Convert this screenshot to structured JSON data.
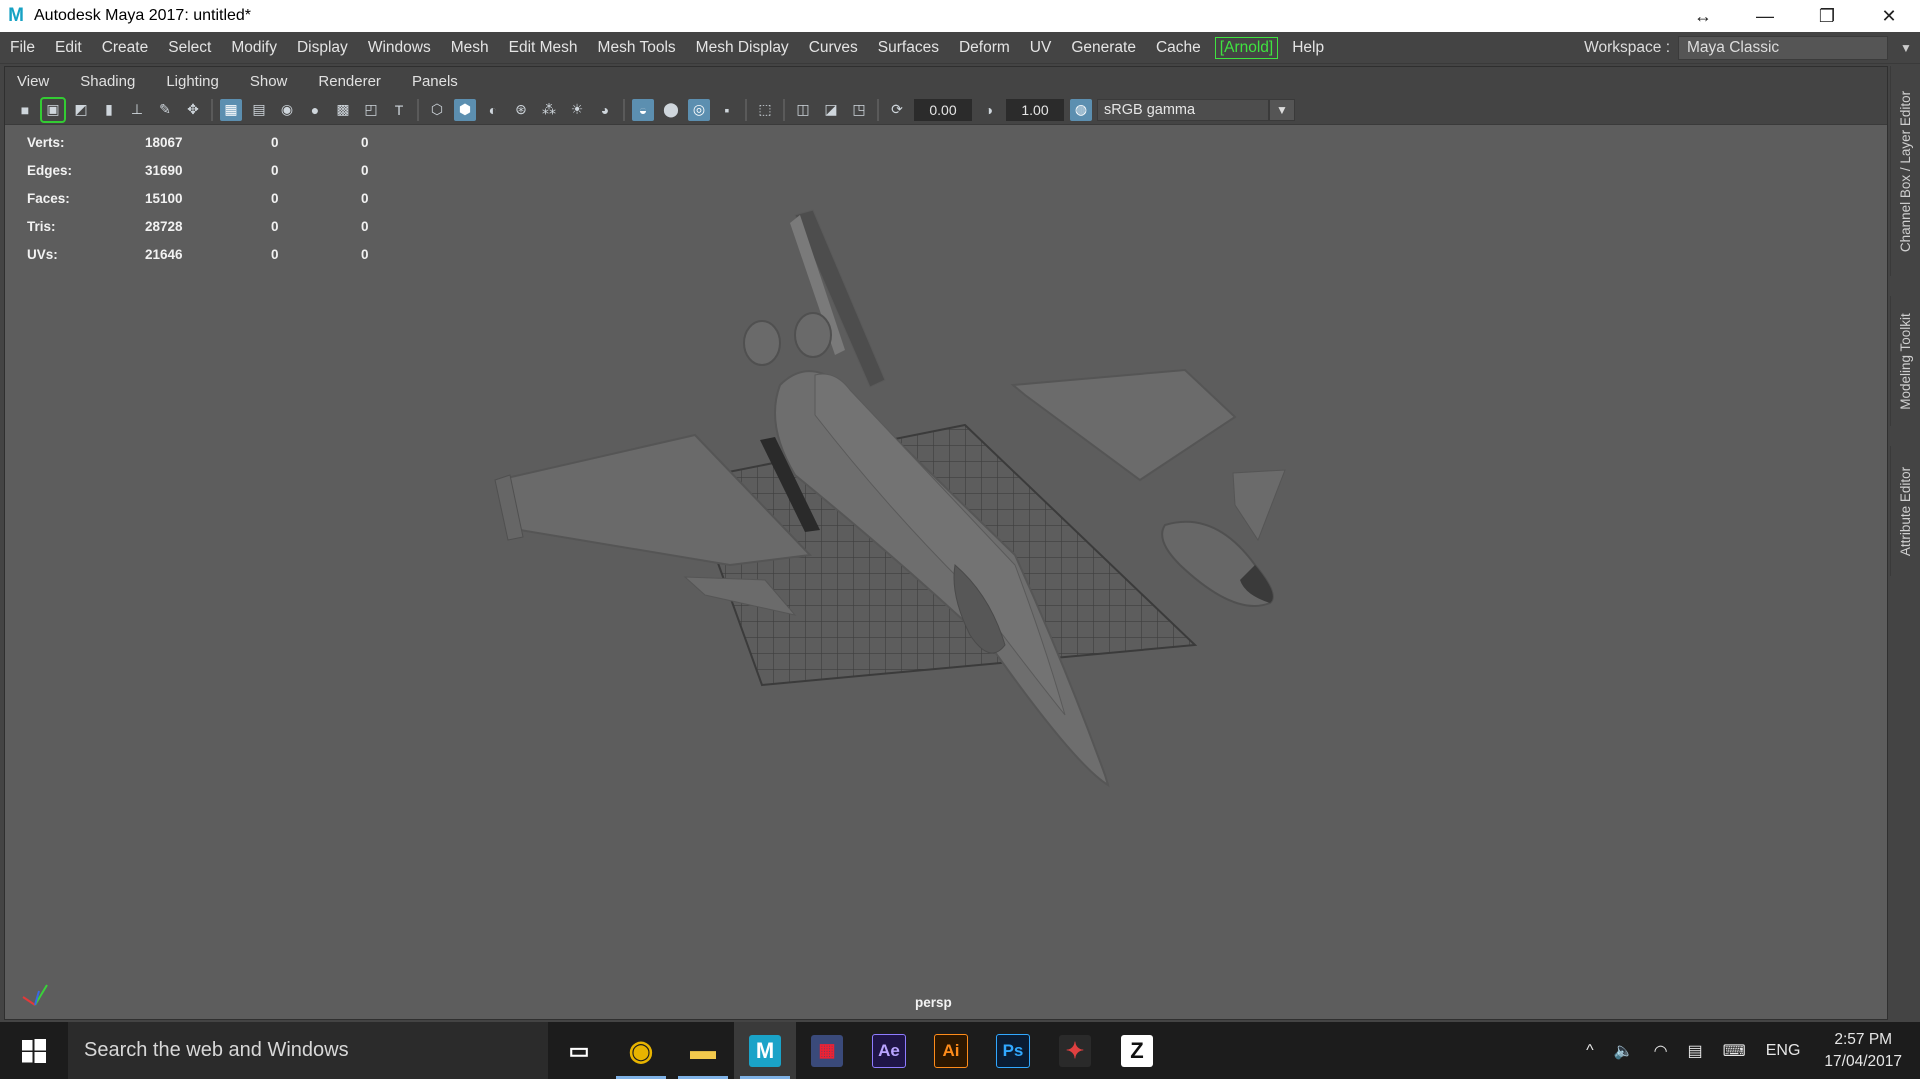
{
  "window": {
    "title": "Autodesk Maya 2017: untitled*",
    "logo_letter": "M",
    "buttons": {
      "resize": "↔",
      "minimize": "—",
      "restore": "❐",
      "close": "✕"
    }
  },
  "menubar": {
    "items": [
      "File",
      "Edit",
      "Create",
      "Select",
      "Modify",
      "Display",
      "Windows",
      "Mesh",
      "Edit Mesh",
      "Mesh Tools",
      "Mesh Display",
      "Curves",
      "Surfaces",
      "Deform",
      "UV",
      "Generate",
      "Cache"
    ],
    "arnold": "[Arnold]",
    "help": "Help",
    "workspace_label": "Workspace :",
    "workspace_value": "Maya Classic"
  },
  "panel_menu": [
    "View",
    "Shading",
    "Lighting",
    "Show",
    "Renderer",
    "Panels"
  ],
  "toolbar": {
    "exposure": "0.00",
    "gamma": "1.00",
    "color_space": "sRGB gamma"
  },
  "hud": {
    "rows": [
      {
        "label": "Verts:",
        "v1": "18067",
        "v2": "0",
        "v3": "0"
      },
      {
        "label": "Edges:",
        "v1": "31690",
        "v2": "0",
        "v3": "0"
      },
      {
        "label": "Faces:",
        "v1": "15100",
        "v2": "0",
        "v3": "0"
      },
      {
        "label": "Tris:",
        "v1": "28728",
        "v2": "0",
        "v3": "0"
      },
      {
        "label": "UVs:",
        "v1": "21646",
        "v2": "0",
        "v3": "0"
      }
    ]
  },
  "camera_label": "persp",
  "side_tabs": [
    "Channel Box / Layer Editor",
    "Modeling Toolkit",
    "Attribute Editor"
  ],
  "taskbar": {
    "search_placeholder": "Search the web and Windows",
    "apps": [
      {
        "name": "task-view",
        "glyph": "▭"
      },
      {
        "name": "chrome",
        "glyph": "◉"
      },
      {
        "name": "file-explorer",
        "glyph": "▬"
      },
      {
        "name": "maya",
        "glyph": "M"
      },
      {
        "name": "media-app",
        "glyph": "▦"
      },
      {
        "name": "after-effects",
        "glyph": "Ae"
      },
      {
        "name": "illustrator",
        "glyph": "Ai"
      },
      {
        "name": "photoshop",
        "glyph": "Ps"
      },
      {
        "name": "game-app",
        "glyph": "✦"
      },
      {
        "name": "zbrush",
        "glyph": "Z"
      }
    ],
    "language": "ENG",
    "time": "2:57 PM",
    "date": "17/04/2017"
  },
  "colors": {
    "viewport_bg": "#5d5d5d",
    "arnold_green": "#3fe33f",
    "active_tool": "#5c8fb0",
    "taskbar": "#1c1c1c"
  }
}
